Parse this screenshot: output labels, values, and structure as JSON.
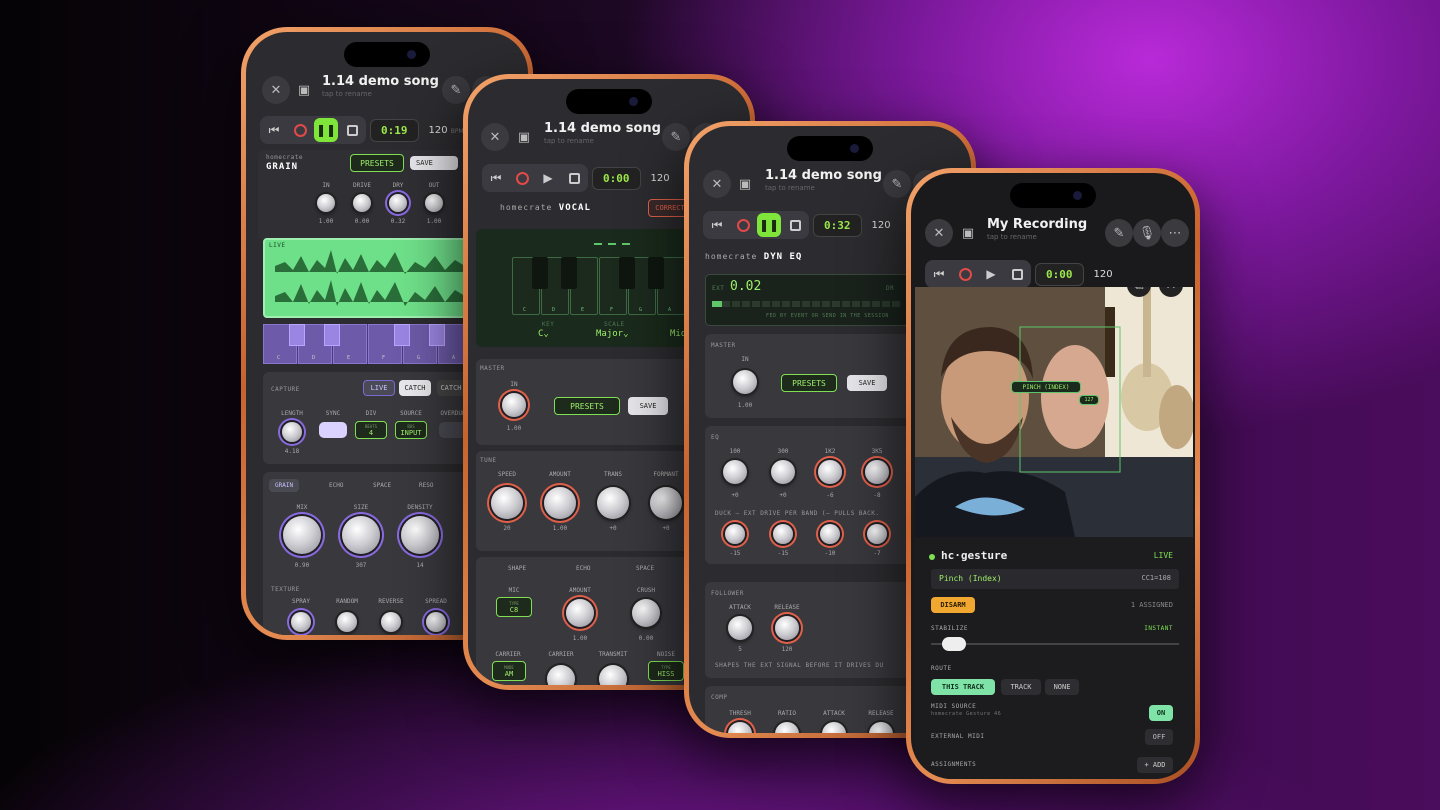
{
  "phone1": {
    "title": "1.14 demo song",
    "subtitle": "tap to rename",
    "time": "0:19",
    "bpm": "120",
    "bpm_unit": "BPM",
    "plugin_brand": "homecrate",
    "plugin_name": "GRAIN",
    "presets": "PRESETS",
    "save": "SAVE",
    "knobs": [
      {
        "label": "IN",
        "value": "1.00"
      },
      {
        "label": "DRIVE",
        "value": "0.00"
      },
      {
        "label": "DRY",
        "value": "0.32"
      },
      {
        "label": "OUT",
        "value": "1.00"
      }
    ],
    "live_label": "LIVE",
    "keys": [
      "C",
      "D",
      "E",
      "F",
      "G",
      "A"
    ],
    "capture": "CAPTURE",
    "live_btn": "LIVE",
    "catch_btn": "CATCH",
    "catch2": "CATCH",
    "length_label": "LENGTH",
    "length_value": "4.18",
    "sync_label": "SYNC",
    "div_label": "DIV",
    "div_small": "BEATS",
    "div_value": "4",
    "source_label": "SOURCE",
    "source_small": "BUS",
    "source_value": "INPUT",
    "overdub_label": "OVERDUB",
    "tabs": [
      "GRAIN",
      "ECHO",
      "SPACE",
      "RESO"
    ],
    "main_knobs": [
      {
        "label": "MIX",
        "value": "0.90"
      },
      {
        "label": "SIZE",
        "value": "307"
      },
      {
        "label": "DENSITY",
        "value": "14"
      }
    ],
    "texture": "TEXTURE",
    "texture_knobs": [
      "SPRAY",
      "RANDOM",
      "REVERSE",
      "SPREAD"
    ]
  },
  "phone2": {
    "title": "1.14 demo song",
    "subtitle": "tap to rename",
    "time": "0:00",
    "bpm": "120",
    "plugin_brand": "homecrate",
    "plugin_name": "VOCAL",
    "correct": "CORRECT",
    "keys": [
      "C",
      "D",
      "E",
      "F",
      "G",
      "A"
    ],
    "key_label": "KEY",
    "scale_label": "SCALE",
    "key_value": "C",
    "scale_value": "Major",
    "mode_value": "Mid",
    "master": "MASTER",
    "in_label": "IN",
    "in_value": "1.00",
    "presets": "PRESETS",
    "save": "SAVE",
    "tune": "TUNE",
    "tune_knobs": [
      {
        "label": "SPEED",
        "value": "20"
      },
      {
        "label": "AMOUNT",
        "value": "1.00"
      },
      {
        "label": "TRANS",
        "value": "+0"
      },
      {
        "label": "FORMANT",
        "value": "+0"
      }
    ],
    "tabs": [
      "SHAPE",
      "ECHO",
      "SPACE"
    ],
    "mic": "MIC",
    "mic_small": "TYPE",
    "mic_value": "C8",
    "amount": "AMOUNT",
    "amount_value": "1.00",
    "crush": "CRUSH",
    "crush_value": "0.00",
    "carrier": "CARRIER",
    "carrier_small": "MODE",
    "carrier_value": "AM",
    "carrier2": "CARRIER",
    "transmit": "TRANSMIT",
    "noise": "NOISE",
    "noise_small": "TYPE",
    "noise_value": "HISS"
  },
  "phone3": {
    "title": "1.14 demo song",
    "subtitle": "tap to rename",
    "time": "0:32",
    "bpm": "120",
    "plugin_brand": "homecrate",
    "plugin_name": "DYN EQ",
    "meter_ext": "EXT",
    "meter_value": "0.02",
    "meter_dr": "DR",
    "meter_caption": "FED BY EVENT OR SEND IN THE SESSION",
    "master": "MASTER",
    "in_label": "IN",
    "in_value": "1.00",
    "presets": "PRESETS",
    "save": "SAVE",
    "eq": "EQ",
    "eq_bands": [
      {
        "label": "100",
        "value": "+0"
      },
      {
        "label": "300",
        "value": "+0"
      },
      {
        "label": "1K2",
        "value": "-6"
      },
      {
        "label": "3K5",
        "value": "-8"
      }
    ],
    "duck_text": "DUCK — EXT DRIVE PER BAND (— PULLS BACK.",
    "duck_values": [
      "-15",
      "-15",
      "-10",
      "-7"
    ],
    "follower": "FOLLOWER",
    "attack": "ATTACK",
    "attack_value": "5",
    "release": "RELEASE",
    "release_value": "120",
    "follower_text": "SHAPES THE EXT SIGNAL BEFORE IT DRIVES DU",
    "comp": "COMP",
    "comp_knobs": [
      "THRESH",
      "RATIO",
      "ATTACK",
      "RELEASE"
    ]
  },
  "phone4": {
    "title": "My Recording",
    "subtitle": "tap to rename",
    "time": "0:00",
    "bpm": "120",
    "gesture_title": "hc·gesture",
    "live": "LIVE",
    "gesture_name": "Pinch (Index)",
    "cc": "CC1=108",
    "detect_label": "PINCH (INDEX)",
    "detect_value": "127",
    "disarm": "DISARM",
    "assigned": "1 ASSIGNED",
    "stabilize": "STABILIZE",
    "instant": "INSTANT",
    "stabilize_level": 0.05,
    "route": "ROUTE",
    "route_options": [
      "THIS TRACK",
      "TRACK",
      "NONE"
    ],
    "midi_source": "MIDI SOURCE",
    "midi_device": "homecrate Gesture 46",
    "on": "ON",
    "external_midi": "EXTERNAL MIDI",
    "off": "OFF",
    "assignments": "ASSIGNMENTS",
    "add": "+ ADD"
  },
  "colors": {
    "accent_green": "#7fe53a",
    "record_red": "#e24a4a",
    "purple": "#8a6adf",
    "frame_orange": "#e58c52"
  }
}
